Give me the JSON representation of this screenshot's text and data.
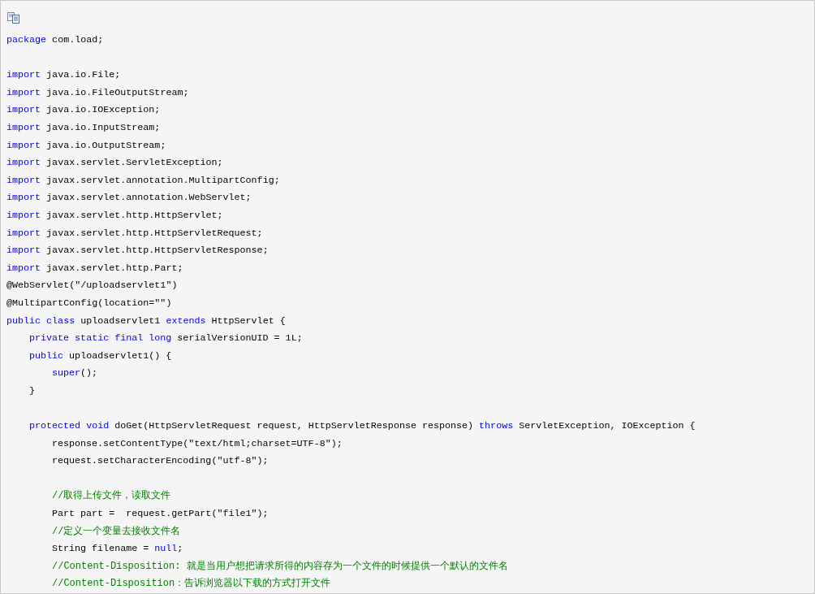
{
  "code_block": {
    "lines": [
      {
        "kind": "code",
        "tokens": [
          {
            "kind": "keyword",
            "text": "package"
          },
          {
            "kind": "plain",
            "text": " com.load;"
          }
        ]
      },
      {
        "kind": "blank"
      },
      {
        "kind": "code",
        "tokens": [
          {
            "kind": "keyword",
            "text": "import"
          },
          {
            "kind": "plain",
            "text": " java.io.File;"
          }
        ]
      },
      {
        "kind": "code",
        "tokens": [
          {
            "kind": "keyword",
            "text": "import"
          },
          {
            "kind": "plain",
            "text": " java.io.FileOutputStream;"
          }
        ]
      },
      {
        "kind": "code",
        "tokens": [
          {
            "kind": "keyword",
            "text": "import"
          },
          {
            "kind": "plain",
            "text": " java.io.IOException;"
          }
        ]
      },
      {
        "kind": "code",
        "tokens": [
          {
            "kind": "keyword",
            "text": "import"
          },
          {
            "kind": "plain",
            "text": " java.io.InputStream;"
          }
        ]
      },
      {
        "kind": "code",
        "tokens": [
          {
            "kind": "keyword",
            "text": "import"
          },
          {
            "kind": "plain",
            "text": " java.io.OutputStream;"
          }
        ]
      },
      {
        "kind": "code",
        "tokens": [
          {
            "kind": "keyword",
            "text": "import"
          },
          {
            "kind": "plain",
            "text": " javax.servlet.ServletException;"
          }
        ]
      },
      {
        "kind": "code",
        "tokens": [
          {
            "kind": "keyword",
            "text": "import"
          },
          {
            "kind": "plain",
            "text": " javax.servlet.annotation.MultipartConfig;"
          }
        ]
      },
      {
        "kind": "code",
        "tokens": [
          {
            "kind": "keyword",
            "text": "import"
          },
          {
            "kind": "plain",
            "text": " javax.servlet.annotation.WebServlet;"
          }
        ]
      },
      {
        "kind": "code",
        "tokens": [
          {
            "kind": "keyword",
            "text": "import"
          },
          {
            "kind": "plain",
            "text": " javax.servlet.http.HttpServlet;"
          }
        ]
      },
      {
        "kind": "code",
        "tokens": [
          {
            "kind": "keyword",
            "text": "import"
          },
          {
            "kind": "plain",
            "text": " javax.servlet.http.HttpServletRequest;"
          }
        ]
      },
      {
        "kind": "code",
        "tokens": [
          {
            "kind": "keyword",
            "text": "import"
          },
          {
            "kind": "plain",
            "text": " javax.servlet.http.HttpServletResponse;"
          }
        ]
      },
      {
        "kind": "code",
        "tokens": [
          {
            "kind": "keyword",
            "text": "import"
          },
          {
            "kind": "plain",
            "text": " javax.servlet.http.Part;"
          }
        ]
      },
      {
        "kind": "code",
        "tokens": [
          {
            "kind": "plain",
            "text": "@WebServlet(\"/uploadservlet1\")"
          }
        ]
      },
      {
        "kind": "code",
        "tokens": [
          {
            "kind": "plain",
            "text": "@MultipartConfig(location=\"\")"
          }
        ]
      },
      {
        "kind": "code",
        "tokens": [
          {
            "kind": "keyword",
            "text": "public class"
          },
          {
            "kind": "plain",
            "text": " uploadservlet1 "
          },
          {
            "kind": "keyword",
            "text": "extends"
          },
          {
            "kind": "plain",
            "text": " HttpServlet {"
          }
        ],
        "children": [
          {
            "kind": "code",
            "tokens": [
              {
                "kind": "keyword",
                "text": "private static final long"
              },
              {
                "kind": "plain",
                "text": " serialVersionUID = 1L;"
              }
            ]
          },
          {
            "kind": "code",
            "tokens": [
              {
                "kind": "keyword",
                "text": "public"
              },
              {
                "kind": "plain",
                "text": " uploadservlet1() {"
              }
            ],
            "children": [
              {
                "kind": "code",
                "tokens": [
                  {
                    "kind": "keyword",
                    "text": "super"
                  },
                  {
                    "kind": "plain",
                    "text": "();"
                  }
                ]
              }
            ]
          },
          {
            "kind": "code",
            "tokens": [
              {
                "kind": "plain",
                "text": "}"
              }
            ]
          },
          {
            "kind": "blank"
          },
          {
            "kind": "code",
            "tokens": [
              {
                "kind": "keyword",
                "text": "protected void"
              },
              {
                "kind": "plain",
                "text": " doGet(HttpServletRequest request, HttpServletResponse response) "
              },
              {
                "kind": "keyword",
                "text": "throws"
              },
              {
                "kind": "plain",
                "text": " ServletException, IOException {"
              }
            ],
            "children": [
              {
                "kind": "code",
                "tokens": [
                  {
                    "kind": "plain",
                    "text": "response.setContentType(\"text/html;charset=UTF-8\");"
                  }
                ]
              },
              {
                "kind": "code",
                "tokens": [
                  {
                    "kind": "plain",
                    "text": "request.setCharacterEncoding(\"utf-8\");"
                  }
                ]
              },
              {
                "kind": "blank"
              },
              {
                "kind": "code",
                "tokens": [
                  {
                    "kind": "comment",
                    "text": "//取得上传文件，读取文件"
                  }
                ]
              },
              {
                "kind": "code",
                "tokens": [
                  {
                    "kind": "plain",
                    "text": "Part part =  request.getPart(\"file1\");"
                  }
                ]
              },
              {
                "kind": "code",
                "tokens": [
                  {
                    "kind": "comment",
                    "text": "//定义一个变量去接收文件名"
                  }
                ]
              },
              {
                "kind": "code",
                "tokens": [
                  {
                    "kind": "plain",
                    "text": "String filename = "
                  },
                  {
                    "kind": "keyword",
                    "text": "null"
                  },
                  {
                    "kind": "plain",
                    "text": ";"
                  }
                ]
              },
              {
                "kind": "code",
                "tokens": [
                  {
                    "kind": "comment",
                    "text": "//Content-Disposition: 就是当用户想把请求所得的内容存为一个文件的时候提供一个默认的文件名"
                  }
                ]
              },
              {
                "kind": "code",
                "tokens": [
                  {
                    "kind": "comment",
                    "text": "//Content-Disposition：告诉浏览器以下载的方式打开文件"
                  }
                ]
              }
            ]
          }
        ]
      }
    ]
  }
}
